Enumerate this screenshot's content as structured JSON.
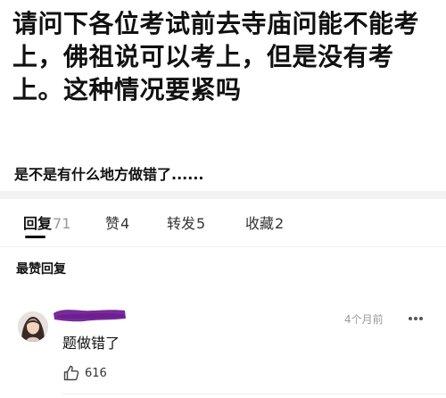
{
  "post": {
    "title": "请问下各位考试前去寺庙问能不能考上，佛祖说可以考上，但是没有考上。这种情况要紧吗",
    "body": "是不是有什么地方做错了......"
  },
  "tabs": [
    {
      "label": "回复",
      "count": "71"
    },
    {
      "label": "赞",
      "count": "4"
    },
    {
      "label": "转发",
      "count": "5"
    },
    {
      "label": "收藏",
      "count": "2"
    }
  ],
  "section": {
    "label": "最赞回复"
  },
  "comment": {
    "time": "4个月前",
    "more": "•••",
    "text": "题做错了",
    "likes": "616"
  },
  "colors": {
    "text": "#111111",
    "muted": "#999999",
    "redaction": "#7a2a9a",
    "divider": "#f2f2f2"
  },
  "icons": {
    "like": "thumbs-up-icon",
    "more": "more-dots-icon"
  }
}
